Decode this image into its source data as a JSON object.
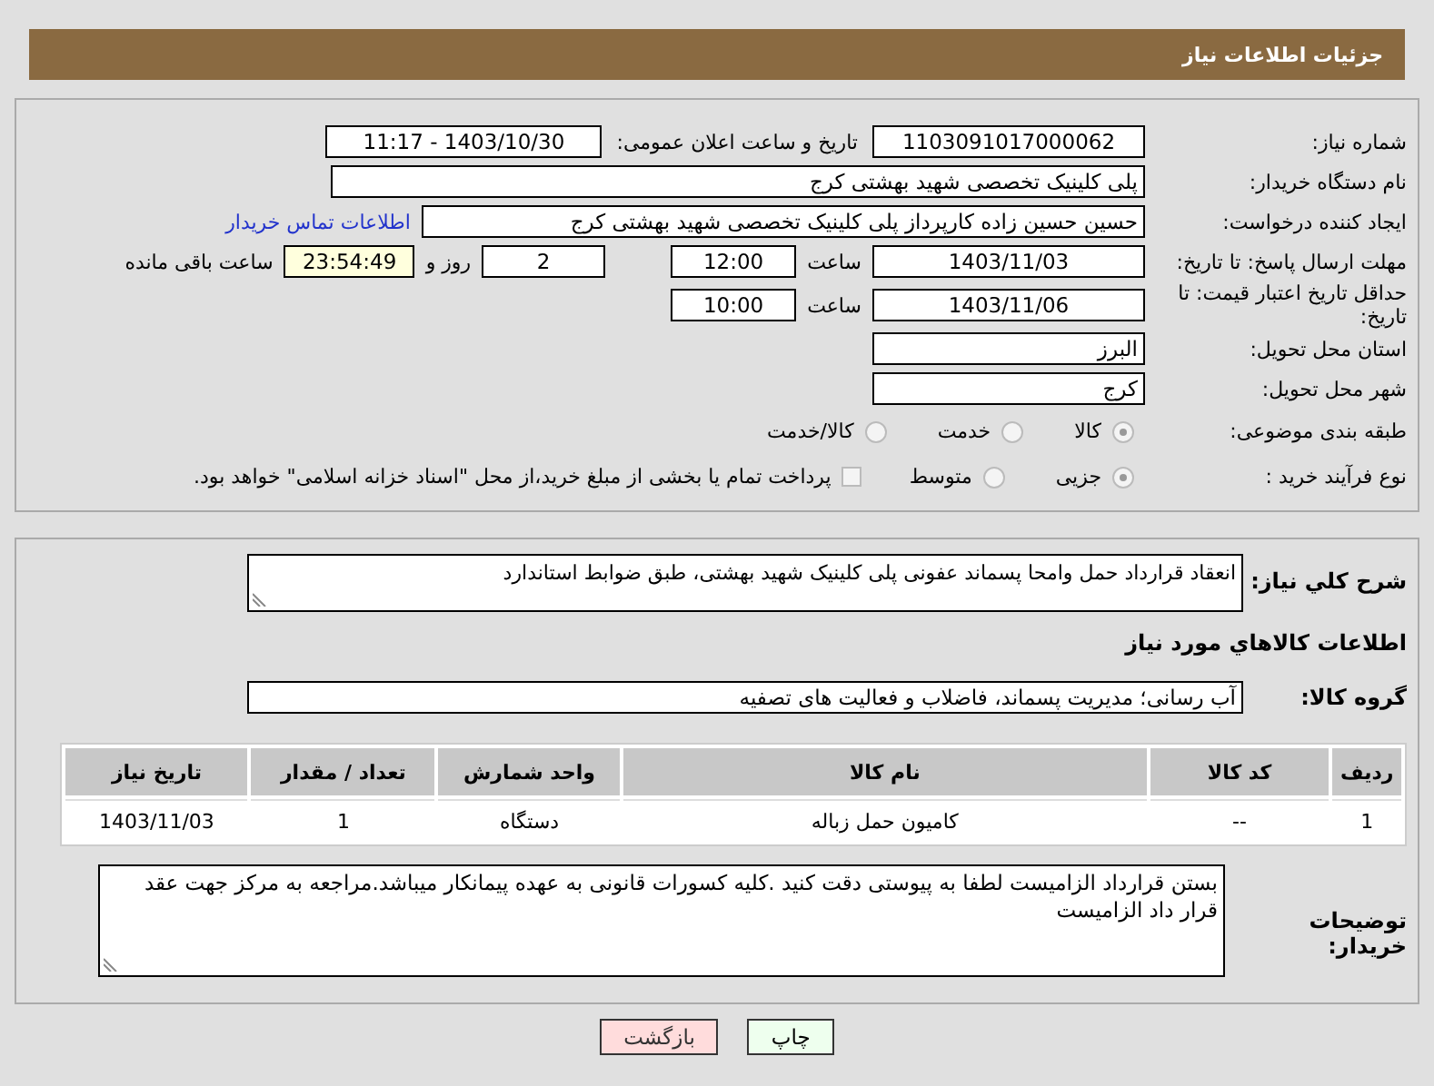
{
  "header": {
    "title": "جزئیات اطلاعات نیاز"
  },
  "need_number": {
    "label": "شماره نیاز:",
    "value": "1103091017000062"
  },
  "announce": {
    "label": "تاریخ و ساعت اعلان عمومی:",
    "value": "1403/10/30 - 11:17"
  },
  "buyer_org": {
    "label": "نام دستگاه خریدار:",
    "value": "پلی کلینیک تخصصی شهید بهشتی کرج"
  },
  "requester": {
    "label": "ایجاد کننده درخواست:",
    "value": "حسین حسین زاده کارپرداز پلی کلینیک تخصصی شهید بهشتی کرج",
    "link": "اطلاعات تماس خریدار"
  },
  "reply_deadline": {
    "label": "مهلت ارسال پاسخ: تا تاریخ:",
    "date": "1403/11/03",
    "time_label": "ساعت",
    "time": "12:00",
    "days": "2",
    "days_label": "روز و",
    "remaining": "23:54:49",
    "remaining_label": "ساعت باقی مانده"
  },
  "price_validity": {
    "label": "حداقل تاریخ اعتبار قیمت: تا تاریخ:",
    "date": "1403/11/06",
    "time_label": "ساعت",
    "time": "10:00"
  },
  "province": {
    "label": "استان محل تحویل:",
    "value": "البرز"
  },
  "city": {
    "label": "شهر محل تحویل:",
    "value": "کرج"
  },
  "category": {
    "label": "طبقه بندی موضوعی:",
    "options": [
      {
        "label": "کالا",
        "selected": true
      },
      {
        "label": "خدمت",
        "selected": false
      },
      {
        "label": "کالا/خدمت",
        "selected": false
      }
    ]
  },
  "process": {
    "label": "نوع فرآیند خرید :",
    "options": [
      {
        "label": "جزیی",
        "selected": true
      },
      {
        "label": "متوسط",
        "selected": false
      }
    ],
    "payment": {
      "checked": false,
      "label": "پرداخت تمام یا بخشی از مبلغ خرید،از محل \"اسناد خزانه اسلامی\" خواهد بود."
    }
  },
  "description": {
    "label": "شرح کلي نياز:",
    "value": "انعقاد قرارداد حمل وامحا پسماند عفونی پلی کلینیک شهید بهشتی، طبق ضوابط استاندارد"
  },
  "goods_title": "اطلاعات کالاهاي مورد نياز",
  "goods_group": {
    "label": "گروه کالا:",
    "value": "آب رسانی؛ مدیریت پسماند، فاضلاب و فعالیت های تصفیه"
  },
  "table": {
    "columns": [
      "ردیف",
      "کد کالا",
      "نام کالا",
      "واحد شمارش",
      "تعداد / مقدار",
      "تاریخ نیاز"
    ],
    "rows": [
      [
        "1",
        "--",
        "کامیون حمل زباله",
        "دستگاه",
        "1",
        "1403/11/03"
      ]
    ]
  },
  "buyer_notes": {
    "label": "توضیحات خریدار:",
    "value": "بستن قرارداد الزامیست لطفا به پیوستی دقت کنید .کلیه کسورات قانونی به عهده پیمانکار میباشد.مراجعه به مرکز جهت عقد قرار داد الزامیست"
  },
  "buttons": [
    {
      "label": "چاپ",
      "kind": "print"
    },
    {
      "label": "بازگشت",
      "kind": "back"
    }
  ]
}
